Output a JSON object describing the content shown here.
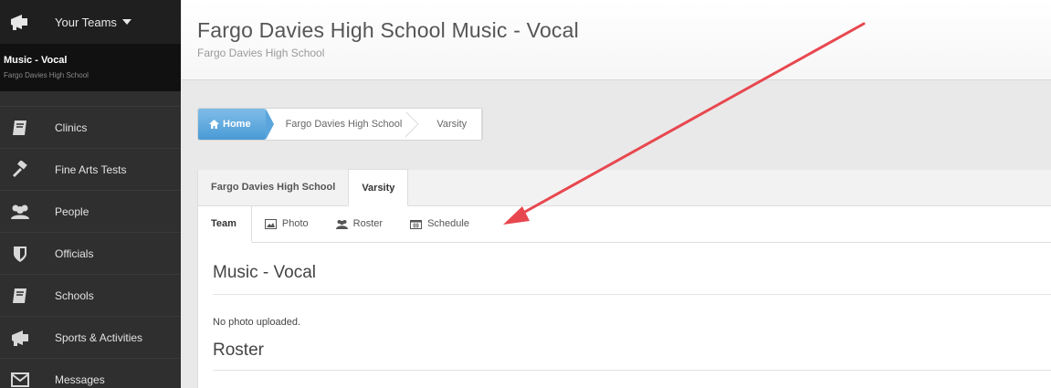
{
  "sidebar": {
    "team_switcher_label": "Your Teams",
    "current_team": {
      "name": "Music - Vocal",
      "school": "Fargo Davies High School"
    },
    "items": [
      {
        "label": "Clinics",
        "icon": "book-icon"
      },
      {
        "label": "Fine Arts Tests",
        "icon": "gavel-icon"
      },
      {
        "label": "People",
        "icon": "group-icon"
      },
      {
        "label": "Officials",
        "icon": "shield-icon"
      },
      {
        "label": "Schools",
        "icon": "book-icon"
      },
      {
        "label": "Sports & Activities",
        "icon": "megaphone-icon"
      },
      {
        "label": "Messages",
        "icon": "envelope-icon"
      }
    ]
  },
  "header": {
    "title": "Fargo Davies High School Music - Vocal",
    "subtitle": "Fargo Davies High School"
  },
  "breadcrumb": {
    "home": "Home",
    "items": [
      "Fargo Davies High School",
      "Varsity"
    ]
  },
  "tabs_level1": [
    "Fargo Davies High School",
    "Varsity"
  ],
  "tabs_level2": [
    "Team",
    "Photo",
    "Roster",
    "Schedule"
  ],
  "content": {
    "section_title": "Music - Vocal",
    "photo_note": "No photo uploaded.",
    "roster_title": "Roster"
  },
  "colors": {
    "sidebar_bg": "#2f2f2f",
    "home_button": "#4a9bd6",
    "annotation_arrow": "#e8474f"
  }
}
